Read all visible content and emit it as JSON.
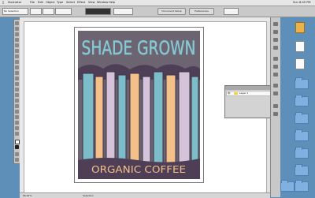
{
  "menubar": {
    "items": [
      "Illustrator",
      "File",
      "Edit",
      "Object",
      "Type",
      "Select",
      "Effect",
      "View",
      "Window",
      "Help"
    ],
    "status": "Sun 8:45 PM"
  },
  "controlbar": {
    "selection_label": "No Selection",
    "document_setup_label": "Document Setup",
    "preferences_label": "Preferences"
  },
  "artwork": {
    "title": "SHADE GROWN",
    "subtitle": "ORGANIC COFFEE"
  },
  "layers": {
    "layer_name": "Layer 1"
  },
  "statusbar": {
    "zoom": "66.67%",
    "mode": "Selection"
  },
  "desktop": {
    "icons": [
      {
        "label": "",
        "kind": "doc"
      },
      {
        "label": "",
        "kind": "doc"
      },
      {
        "label": "",
        "kind": "doc"
      },
      {
        "label": "",
        "kind": "folder"
      },
      {
        "label": "",
        "kind": "folder"
      },
      {
        "label": "",
        "kind": "folder"
      },
      {
        "label": "",
        "kind": "folder"
      },
      {
        "label": "",
        "kind": "folder"
      },
      {
        "label": "",
        "kind": "folder"
      },
      {
        "label": "",
        "kind": "folder"
      },
      {
        "label": "",
        "kind": "folder"
      }
    ]
  },
  "colors": {
    "desktop": "#5d8fb8",
    "poster_bg": "#6c6470",
    "tree_blue": "#7dbcc9",
    "tree_peach": "#f4c08a",
    "tree_lilac": "#d5c3d9",
    "trunk": "#4e3f57"
  }
}
